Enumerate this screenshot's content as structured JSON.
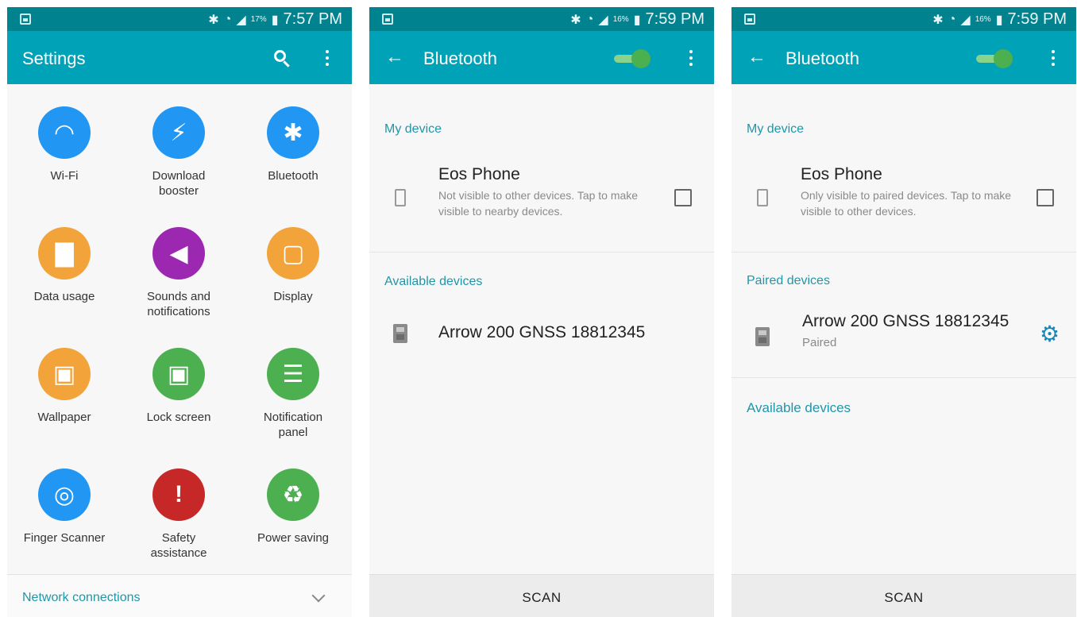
{
  "colors": {
    "status_bar": "#00838f",
    "app_bar": "#00a2b8",
    "accent_text": "#2196a8",
    "toggle_on": "#4caf50",
    "gear": "#1a86b8"
  },
  "screens": [
    {
      "status": {
        "battery": "17%",
        "time": "7:57 PM"
      },
      "title": "Settings",
      "icons": [
        "search-icon",
        "more-vert-icon"
      ],
      "tiles": [
        {
          "label": "Wi-Fi",
          "icon": "wifi-icon",
          "color": "#2196f3",
          "glyph": "◠"
        },
        {
          "label": "Download\nbooster",
          "icon": "download-booster-icon",
          "color": "#2196f3",
          "glyph": "⚡"
        },
        {
          "label": "Bluetooth",
          "icon": "bluetooth-icon",
          "color": "#2196f3",
          "glyph": "✱"
        },
        {
          "label": "Data usage",
          "icon": "data-usage-icon",
          "color": "#f2a33a",
          "glyph": "▇"
        },
        {
          "label": "Sounds and\nnotifications",
          "icon": "sound-icon",
          "color": "#9c27b0",
          "glyph": "◀"
        },
        {
          "label": "Display",
          "icon": "display-icon",
          "color": "#f2a33a",
          "glyph": "▢"
        },
        {
          "label": "Wallpaper",
          "icon": "wallpaper-icon",
          "color": "#f2a33a",
          "glyph": "▣"
        },
        {
          "label": "Lock screen",
          "icon": "lock-screen-icon",
          "color": "#4caf50",
          "glyph": "▣"
        },
        {
          "label": "Notification\npanel",
          "icon": "notification-panel-icon",
          "color": "#4caf50",
          "glyph": "☰"
        },
        {
          "label": "Finger Scanner",
          "icon": "fingerprint-icon",
          "color": "#2196f3",
          "glyph": "◎"
        },
        {
          "label": "Safety\nassistance",
          "icon": "safety-icon",
          "color": "#c62828",
          "glyph": "!"
        },
        {
          "label": "Power saving",
          "icon": "power-saving-icon",
          "color": "#4caf50",
          "glyph": "♻"
        }
      ],
      "footer": "Network connections"
    },
    {
      "status": {
        "battery": "16%",
        "time": "7:59 PM"
      },
      "title": "Bluetooth",
      "toggle": "on",
      "my_device_label": "My device",
      "my_device": {
        "name": "Eos Phone",
        "desc": "Not visible to other devices. Tap to make visible to nearby devices."
      },
      "available_label": "Available devices",
      "available": [
        {
          "name": "Arrow 200 GNSS 18812345"
        }
      ],
      "scan": "SCAN"
    },
    {
      "status": {
        "battery": "16%",
        "time": "7:59 PM"
      },
      "title": "Bluetooth",
      "toggle": "on",
      "my_device_label": "My device",
      "my_device": {
        "name": "Eos Phone",
        "desc": "Only visible to paired devices. Tap to make visible to other devices."
      },
      "paired_label": "Paired devices",
      "paired": [
        {
          "name": "Arrow 200 GNSS 18812345",
          "status": "Paired"
        }
      ],
      "available_label": "Available devices",
      "scan": "SCAN"
    }
  ]
}
